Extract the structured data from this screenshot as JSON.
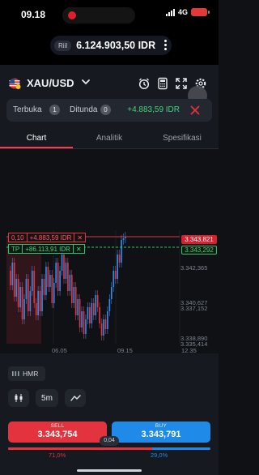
{
  "status_bar": {
    "time": "09.18",
    "network": "4G",
    "battery_color": "#e23a3a",
    "recording_color": "#e01d2f"
  },
  "account": {
    "type_label": "Riil",
    "balance": "6.124.903,50 IDR"
  },
  "instrument": {
    "symbol": "XAU/USD",
    "toolbar_icons": [
      "alarm-icon",
      "calculator-icon",
      "expand-icon",
      "settings-icon"
    ]
  },
  "orders": {
    "open_label": "Terbuka",
    "open_count": "1",
    "pending_label": "Ditunda",
    "pending_count": "0",
    "profit": "+4.883,59 IDR"
  },
  "tabs": [
    {
      "label": "Chart",
      "active": true
    },
    {
      "label": "Analitik",
      "active": false
    },
    {
      "label": "Spesifikasi",
      "active": false
    }
  ],
  "chart": {
    "stop_line": {
      "lot": "0,10",
      "profit": "+4.883,59 IDR",
      "price": "3.343,821",
      "color": "#e0323f"
    },
    "tp_line": {
      "label": "TP",
      "profit": "+86.113,91 IDR",
      "price": "3.343,292",
      "color": "#30c46a"
    },
    "price_labels": [
      "3.342,365",
      "3.340,627",
      "3.338,890",
      "3.337,152",
      "3.335,414"
    ],
    "time_labels": [
      "06.05",
      "09.15",
      "12.35"
    ],
    "up_color": "#2c8be8",
    "down_color": "#e2333f"
  },
  "controls": {
    "indicator_label": "HMR",
    "timeframe": "5m",
    "candle_icon": "candlestick-icon",
    "draw_icon": "line-drawing-icon"
  },
  "trade": {
    "sell_label": "SELL",
    "sell_price": "3.343,754",
    "buy_label": "BUY",
    "buy_price": "3.343,791",
    "spread": "0,04",
    "sell_percent": "71,0%",
    "buy_percent": "29,0%",
    "sell_fraction": 0.71,
    "sell_color": "#e2333f",
    "buy_color": "#1f8ae8"
  }
}
